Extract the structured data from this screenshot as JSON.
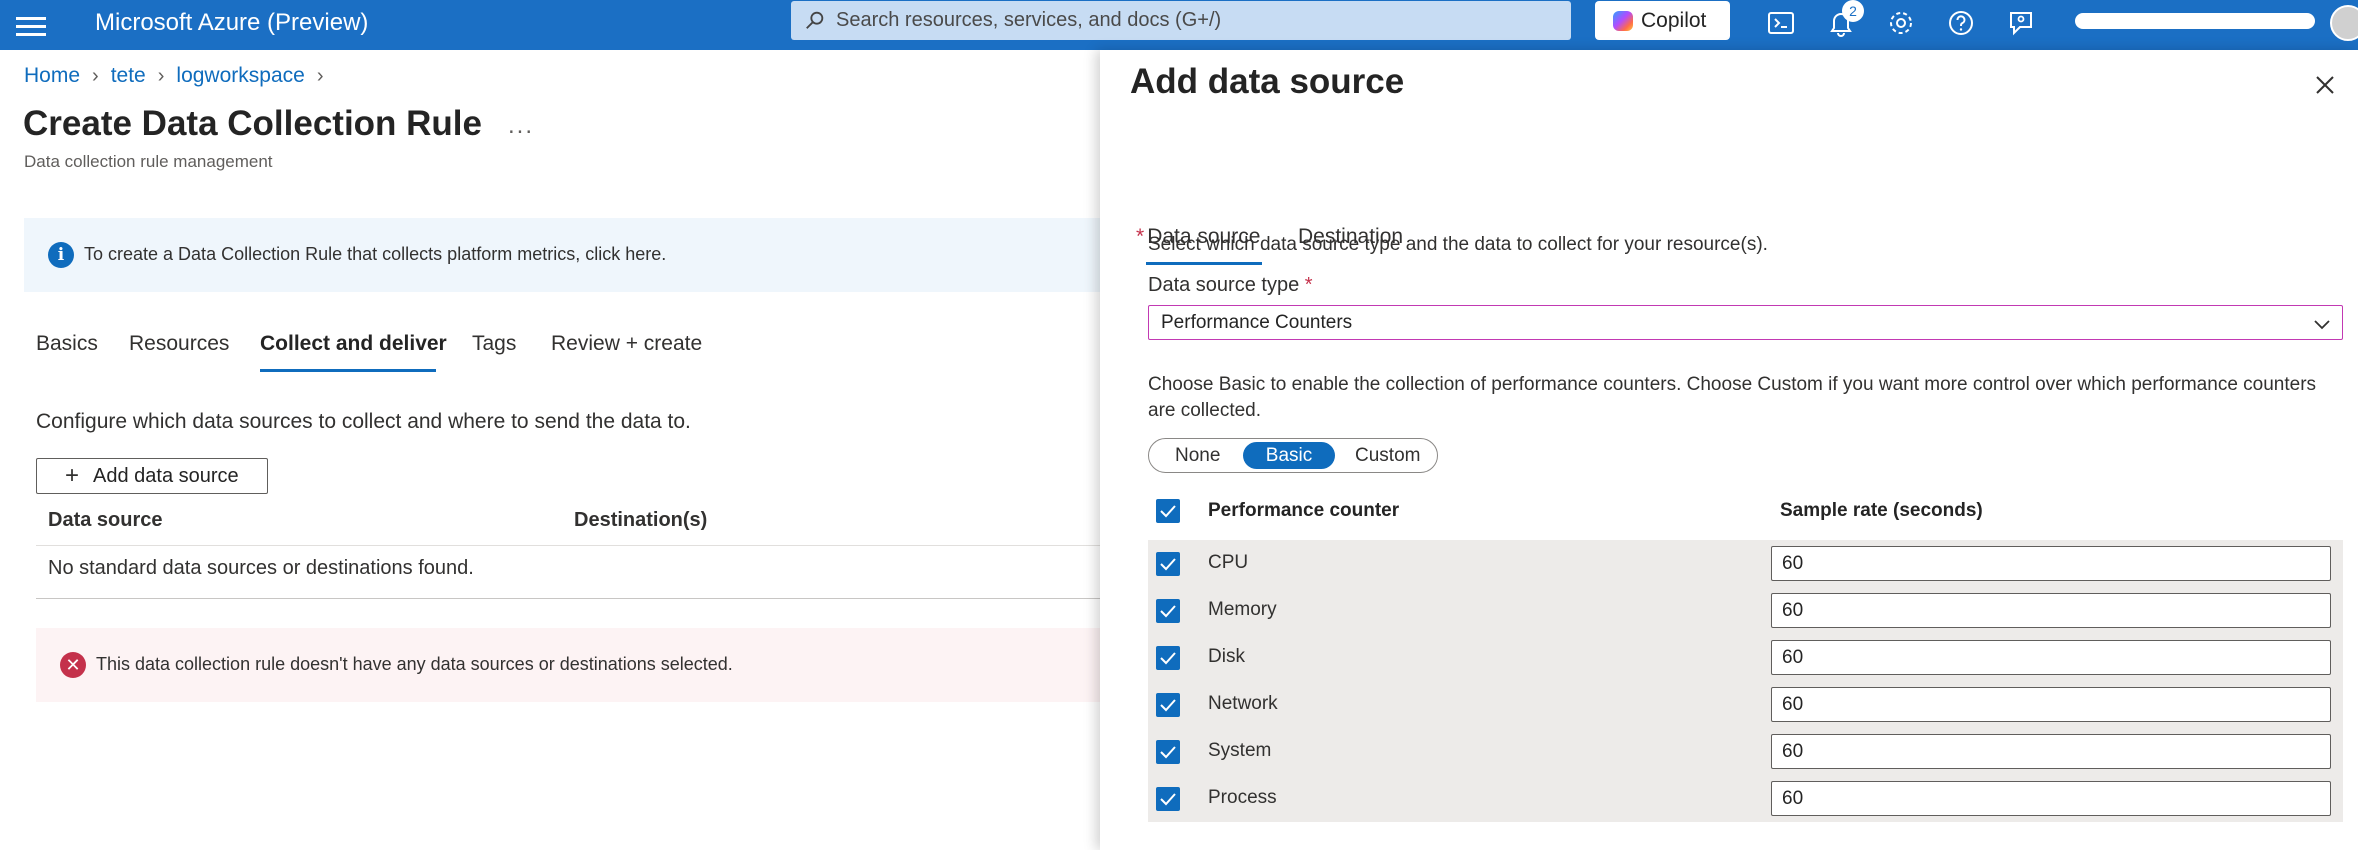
{
  "topbar": {
    "brand": "Microsoft Azure (Preview)",
    "search_placeholder": "Search resources, services, and docs (G+/)",
    "copilot_label": "Copilot",
    "notification_count": "2"
  },
  "breadcrumb": [
    "Home",
    "tete",
    "logworkspace"
  ],
  "page": {
    "title": "Create Data Collection Rule",
    "more": "...",
    "subtitle": "Data collection rule management"
  },
  "info_message": "To create a Data Collection Rule that collects platform metrics, click here.",
  "tabs": [
    "Basics",
    "Resources",
    "Collect and deliver",
    "Tags",
    "Review + create"
  ],
  "active_tab": "Collect and deliver",
  "collect": {
    "description": "Configure which data sources to collect and where to send the data to.",
    "add_button": "Add data source",
    "columns": [
      "Data source",
      "Destination(s)"
    ],
    "empty_text": "No standard data sources or destinations found.",
    "error_message": "This data collection rule doesn't have any data sources or destinations selected."
  },
  "panel": {
    "title": "Add data source",
    "tabs": [
      "Data source",
      "Destination"
    ],
    "required_marker": "*",
    "description": "Select which data source type and the data to collect for your resource(s).",
    "type_label": "Data source type",
    "type_value": "Performance Counters",
    "choose_text": "Choose Basic to enable the collection of performance counters. Choose Custom if you want more control over which performance counters are collected.",
    "modes": [
      "None",
      "Basic",
      "Custom"
    ],
    "selected_mode": "Basic",
    "table_headers": [
      "Performance counter",
      "Sample rate (seconds)"
    ],
    "counters": [
      {
        "name": "CPU",
        "rate": "60",
        "checked": true
      },
      {
        "name": "Memory",
        "rate": "60",
        "checked": true
      },
      {
        "name": "Disk",
        "rate": "60",
        "checked": true
      },
      {
        "name": "Network",
        "rate": "60",
        "checked": true
      },
      {
        "name": "System",
        "rate": "60",
        "checked": true
      },
      {
        "name": "Process",
        "rate": "60",
        "checked": true
      }
    ]
  },
  "colors": {
    "topbar": "#1b6fc4",
    "accent": "#0f6cbd",
    "error": "#c4314b",
    "info_bg": "#eff6fc",
    "error_bg": "#fdf3f4"
  }
}
